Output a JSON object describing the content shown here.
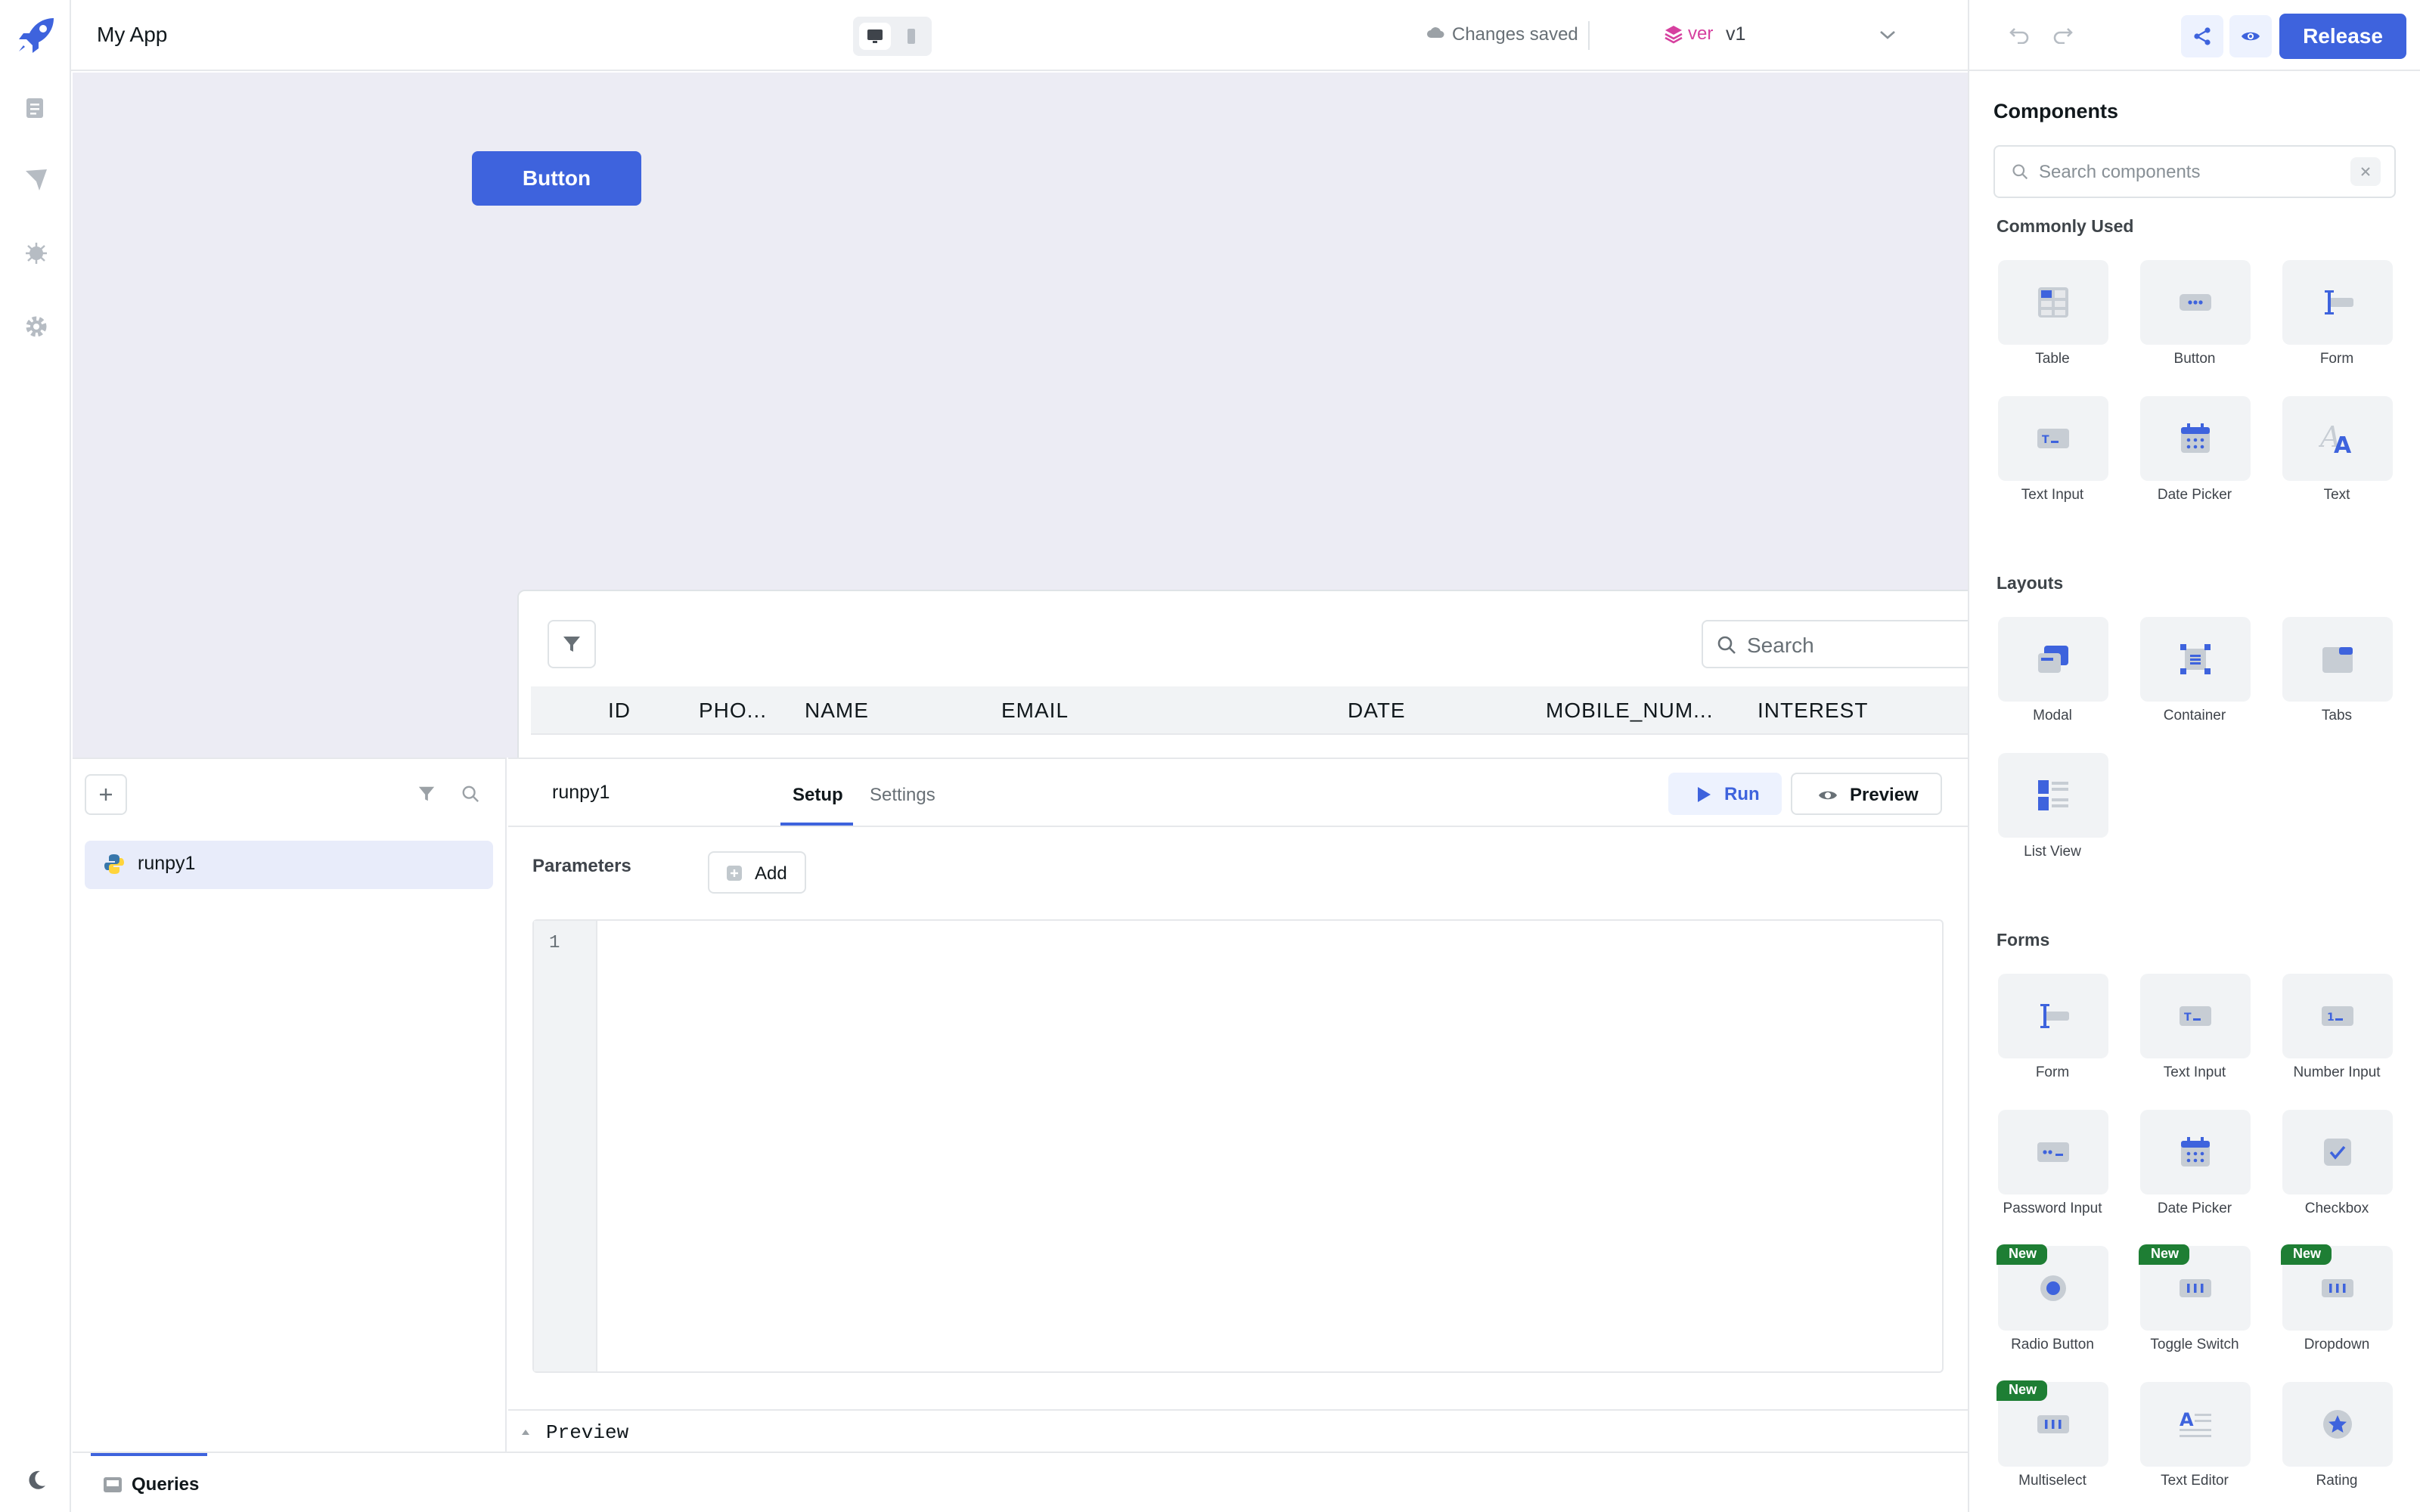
{
  "app": {
    "name": "My App"
  },
  "topbar": {
    "save_status": "Changes saved",
    "version_label": "ver",
    "version_value": "v1",
    "release_label": "Release"
  },
  "canvas": {
    "button_label": "Button",
    "table": {
      "search_placeholder": "Search",
      "columns": [
        "ID",
        "PHO...",
        "NAME",
        "EMAIL",
        "DATE",
        "MOBILE_NUM...",
        "INTEREST"
      ]
    }
  },
  "queries": {
    "items": [
      {
        "name": "runpy1"
      }
    ],
    "tab_label": "Queries"
  },
  "editor": {
    "query_name": "runpy1",
    "tabs": [
      "Setup",
      "Settings"
    ],
    "active_tab": "Setup",
    "run_label": "Run",
    "preview_label": "Preview",
    "parameters_label": "Parameters",
    "add_label": "Add",
    "line_number": "1",
    "preview_section_label": "Preview"
  },
  "components": {
    "title": "Components",
    "search_placeholder": "Search components",
    "sections": [
      {
        "title": "Commonly Used",
        "items": [
          {
            "label": "Table",
            "icon": "table-icon"
          },
          {
            "label": "Button",
            "icon": "button-icon"
          },
          {
            "label": "Form",
            "icon": "form-icon"
          },
          {
            "label": "Text Input",
            "icon": "text-input-icon"
          },
          {
            "label": "Date Picker",
            "icon": "date-picker-icon"
          },
          {
            "label": "Text",
            "icon": "text-icon"
          }
        ]
      },
      {
        "title": "Layouts",
        "items": [
          {
            "label": "Modal",
            "icon": "modal-icon"
          },
          {
            "label": "Container",
            "icon": "container-icon"
          },
          {
            "label": "Tabs",
            "icon": "tabs-icon"
          },
          {
            "label": "List View",
            "icon": "list-view-icon"
          }
        ]
      },
      {
        "title": "Forms",
        "items": [
          {
            "label": "Form",
            "icon": "form-icon"
          },
          {
            "label": "Text Input",
            "icon": "text-input-icon"
          },
          {
            "label": "Number Input",
            "icon": "number-input-icon"
          },
          {
            "label": "Password Input",
            "icon": "password-input-icon"
          },
          {
            "label": "Date Picker",
            "icon": "date-picker-icon"
          },
          {
            "label": "Checkbox",
            "icon": "checkbox-icon"
          },
          {
            "label": "Radio Button",
            "icon": "radio-button-icon",
            "badge": "New"
          },
          {
            "label": "Toggle Switch",
            "icon": "toggle-switch-icon",
            "badge": "New"
          },
          {
            "label": "Dropdown",
            "icon": "dropdown-icon",
            "badge": "New"
          },
          {
            "label": "Multiselect",
            "icon": "multiselect-icon",
            "badge": "New"
          },
          {
            "label": "Text Editor",
            "icon": "text-editor-icon"
          },
          {
            "label": "Rating",
            "icon": "rating-icon"
          }
        ]
      }
    ]
  },
  "colors": {
    "primary": "#3e63dd",
    "badge": "#1e7e34",
    "canvas": "#ececf4"
  }
}
